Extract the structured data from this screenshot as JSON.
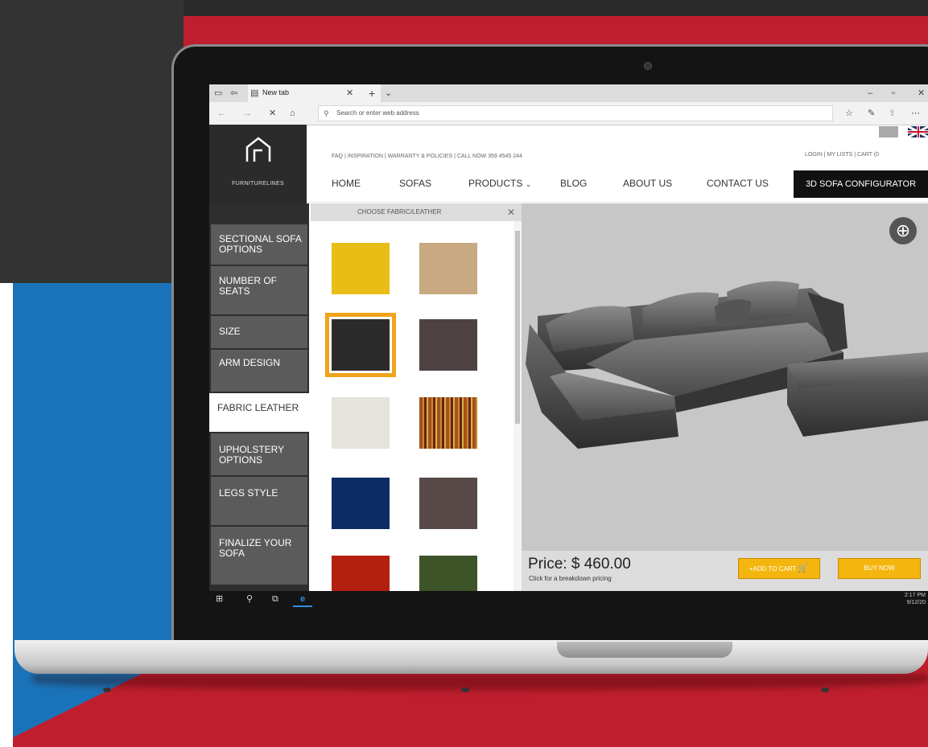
{
  "browser": {
    "tab_title": "New tab",
    "address_placeholder": "Search or enter web address"
  },
  "site": {
    "logo_text": "FURNITURELINES",
    "top_links": "FAQ  |  INSPIRATION  |  WARRANTY & POLICIES  |  CALL NOW 359  4545 244",
    "account_links": "LOGIN  |  MY LISTS  |  CART (0",
    "nav": [
      "HOME",
      "SOFAS",
      "PRODUCTS",
      "BLOG",
      "ABOUT US",
      "CONTACT US"
    ],
    "nav_config": "3D SOFA CONFIGURATOR"
  },
  "options": [
    {
      "label": "SECTIONAL SOFA OPTIONS"
    },
    {
      "label": "NUMBER OF SEATS"
    },
    {
      "label": "SIZE"
    },
    {
      "label": "ARM DESIGN"
    },
    {
      "label": "FABRIC LEATHER",
      "active": true
    },
    {
      "label": "UPHOLSTERY OPTIONS"
    },
    {
      "label": "LEGS STYLE"
    },
    {
      "label": "FINALIZE YOUR SOFA"
    }
  ],
  "fabric_panel": {
    "title": "CHOOSE FABRIC/LEATHER",
    "swatch_colors": [
      "#e8be16",
      "#c9a982",
      "#2b2b2b",
      "#4e4242",
      "#e4e4dc",
      "#a5521c",
      "#0d2c63",
      "#574a48",
      "#b32010",
      "#3c5427"
    ],
    "selected_index": 2
  },
  "viewer": {
    "price": "Price: $ 460.00",
    "price_note": "Click for a breakdown pricing",
    "add_to_cart": "+ADD TO CART",
    "buy_now": "BUY NOW"
  },
  "taskbar": {
    "time": "2:17 PM",
    "date": "9/12/20"
  },
  "colors": {
    "background_red": "#bf1e2e",
    "background_blue": "#1a73b8",
    "accent_yellow": "#f5b50f"
  }
}
